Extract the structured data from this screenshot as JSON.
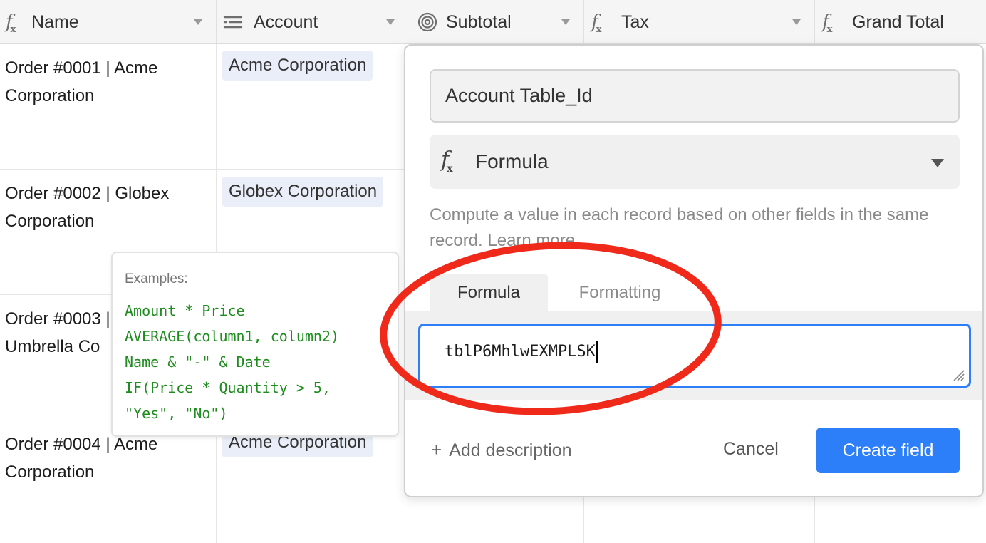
{
  "columns": [
    {
      "label": "Name",
      "icon": "formula-icon"
    },
    {
      "label": "Account",
      "icon": "linked-record-icon"
    },
    {
      "label": "Subtotal",
      "icon": "rollup-icon"
    },
    {
      "label": "Tax",
      "icon": "formula-icon"
    },
    {
      "label": "Grand Total",
      "icon": "formula-icon"
    }
  ],
  "rows": [
    {
      "name_line1": "Order #0001 | Acme",
      "name_line2": "Corporation",
      "account": "Acme Corporation"
    },
    {
      "name_line1": "Order #0002 | Globex",
      "name_line2": "Corporation",
      "account": "Globex Corporation"
    },
    {
      "name_line1": "Order #0003 |",
      "name_line2": "Umbrella Co",
      "account": ""
    },
    {
      "name_line1": "Order #0004 | Acme",
      "name_line2": "Corporation",
      "account": "Acme Corporation"
    }
  ],
  "examples": {
    "title": "Examples:",
    "lines": [
      "Amount * Price",
      "AVERAGE(column1, column2)",
      "Name & \"-\" & Date",
      "IF(Price * Quantity > 5,",
      "\"Yes\", \"No\")"
    ]
  },
  "panel": {
    "field_name": "Account Table_Id",
    "field_type": "Formula",
    "help_text": "Compute a value in each record based on other fields in the same record.",
    "help_link": "Learn more",
    "tabs": [
      "Formula",
      "Formatting"
    ],
    "formula_value": "tblP6MhlwEXMPLSK",
    "add_description": "Add description",
    "cancel_label": "Cancel",
    "create_label": "Create field"
  },
  "colors": {
    "accent": "#2d7ff9",
    "annotation": "#f02a1a",
    "example_code": "#1e8c1e",
    "chip_bg": "#e9eef8"
  }
}
